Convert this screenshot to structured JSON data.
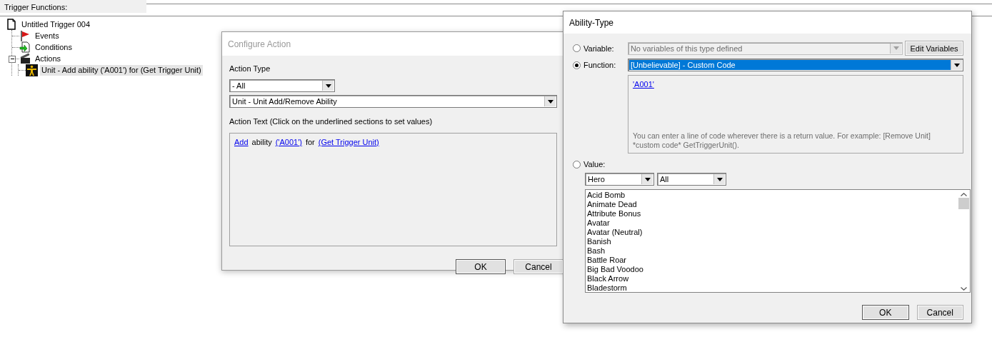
{
  "trigger_panel": {
    "title": "Trigger Functions:",
    "tree": [
      {
        "label": "Untitled Trigger 004",
        "kind": "trigger",
        "selected": false,
        "children": [
          {
            "label": "Events",
            "kind": "events",
            "selected": false
          },
          {
            "label": "Conditions",
            "kind": "conditions",
            "selected": false
          },
          {
            "label": "Actions",
            "kind": "actions",
            "selected": false,
            "expanded": true,
            "children": [
              {
                "label": "Unit - Add ability ('A001') for (Get Trigger Unit)",
                "kind": "action",
                "selected": true
              }
            ]
          }
        ]
      }
    ]
  },
  "configure_dialog": {
    "title": "Configure Action",
    "action_type_label": "Action Type",
    "category_dropdown": "- All",
    "action_dropdown": "Unit - Unit Add/Remove Ability",
    "action_text_label": "Action Text (Click on the underlined sections to set values)",
    "action_text": [
      {
        "text": "Add",
        "kind": "link"
      },
      {
        "text": "ability",
        "kind": "plain"
      },
      {
        "text": "('A001')",
        "kind": "link"
      },
      {
        "text": "for",
        "kind": "plain"
      },
      {
        "text": "(Get Trigger Unit)",
        "kind": "link"
      }
    ],
    "buttons": [
      "OK",
      "Cancel"
    ]
  },
  "ability_dialog": {
    "title": "Ability-Type",
    "variable": {
      "label": "Variable:",
      "selected": false,
      "dropdown": {
        "value": "No variables of this type defined",
        "disabled": true
      },
      "button": "Edit Variables"
    },
    "function": {
      "label": "Function:",
      "selected": true,
      "dropdown": {
        "value": "[Unbelievable] - Custom Code",
        "highlighted": true
      },
      "preview_link": "'A001'",
      "hint": "You can enter a line of code wherever there is a return value. For example: [Remove Unit] *custom code* GetTriggerUnit()."
    },
    "value": {
      "label": "Value:",
      "selected": false,
      "filters": [
        "Hero",
        "All"
      ],
      "items": [
        "Acid Bomb",
        "Animate Dead",
        "Attribute Bonus",
        "Avatar",
        "Avatar (Neutral)",
        "Banish",
        "Bash",
        "Battle Roar",
        "Big Bad Voodoo",
        "Black Arrow",
        "Bladestorm"
      ]
    },
    "buttons": [
      "OK",
      "Cancel"
    ]
  }
}
